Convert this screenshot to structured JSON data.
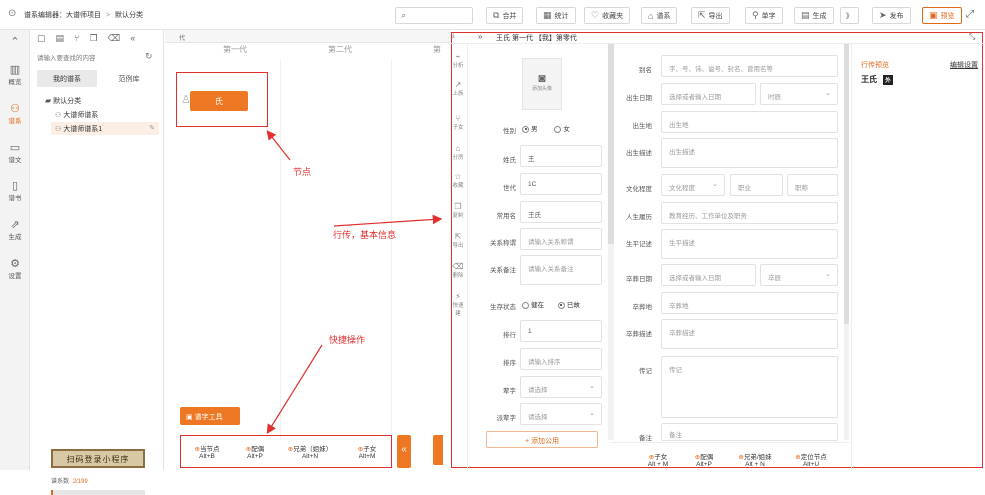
{
  "topbar": {
    "breadcrumb": {
      "root": "谱系编辑器：大谱师项目",
      "sep": ">",
      "current": "默认分类"
    },
    "search_icon": "search-icon",
    "buttons": [
      {
        "label": "合并"
      },
      {
        "label": "统计"
      },
      {
        "label": "收藏夹"
      },
      {
        "label": "谱系"
      },
      {
        "label": "导出"
      },
      {
        "label": "单字"
      },
      {
        "label": "生成"
      },
      {
        "label": "》"
      },
      {
        "label": "发布"
      },
      {
        "label": "预览"
      }
    ]
  },
  "leftbar": {
    "items": [
      {
        "label": "概览",
        "icon": "chart-icon"
      },
      {
        "label": "谱系",
        "icon": "people-icon",
        "active": true
      },
      {
        "label": "谱文",
        "icon": "document-icon"
      },
      {
        "label": "谱书",
        "icon": "book-icon"
      },
      {
        "label": "生成",
        "icon": "generate-icon"
      },
      {
        "label": "设置",
        "icon": "gear-icon"
      }
    ]
  },
  "tree": {
    "search_placeholder": "请输入要查找的内容",
    "tabs": [
      {
        "label": "我的谱系"
      },
      {
        "label": "范例库"
      }
    ],
    "folder": "默认分类",
    "items": [
      {
        "label": "大谱师谱系"
      },
      {
        "label": "大谱师谱系1"
      }
    ],
    "promo": "扫码登录小程序",
    "count_label": "谱系数",
    "count_value": "2/199"
  },
  "canvas": {
    "tab_label": "代",
    "columns": [
      "第一代",
      "第二代",
      "第"
    ],
    "node_label": "氏",
    "tool_button": "谱字工具",
    "shortcuts": [
      {
        "name": "当节点",
        "key": "Alt+B"
      },
      {
        "name": "配偶",
        "key": "Alt+P"
      },
      {
        "name": "兄弟（姐妹）",
        "key": "Alt+N"
      },
      {
        "name": "子女",
        "key": "Alt+M"
      }
    ]
  },
  "annotations": {
    "node": "节点",
    "panel": "行传，基本信息",
    "operation": "快捷操作"
  },
  "panel": {
    "header": "王氏 第一代 【我】第零代",
    "side_tabs": [
      "分析",
      "上族",
      "子女",
      "分房",
      "收藏",
      "复制",
      "导出",
      "删除",
      "快速建"
    ],
    "photo_label": "添加头像",
    "gender_label": "性别",
    "gender_male": "男",
    "gender_female": "女",
    "surname_label": "姓氏",
    "surname_value": "王",
    "gen_label": "世代",
    "gen_value": "1C",
    "common_name_label": "常用名",
    "common_name_value": "王氏",
    "relation_label": "关系称谓",
    "relation_placeholder": "请输入关系称谓",
    "relation_note_label": "关系备注",
    "relation_note_placeholder": "请输入关系备注",
    "alive_label": "生存状态",
    "alive_yes": "健在",
    "alive_no": "已故",
    "rank_label": "排行",
    "rank_value": "1",
    "order_label": "排序",
    "order_placeholder": "请输入排序",
    "gen_char_label": "辈字",
    "gen_char_placeholder": "请选择",
    "gen_char2_label": "派辈字",
    "gen_char2_placeholder": "请选择",
    "add_public_button": "+ 添加公用",
    "alias_label": "别名",
    "alias_placeholder": "字、号、讳、谥号、封名、曾用名等",
    "birth_date_label": "出生日期",
    "birth_date_placeholder": "选择或者输入日期",
    "birth_hour_placeholder": "时辰",
    "birthplace_label": "出生地",
    "birthplace_placeholder": "出生地",
    "birth_desc_label": "出生描述",
    "birth_desc_placeholder": "出生描述",
    "education_label": "文化程度",
    "education_placeholder": "文化程度",
    "job_placeholder": "职业",
    "title_placeholder": "职称",
    "career_label": "人生履历",
    "career_placeholder": "教育经历、工作单位及职务",
    "life_label": "生平记述",
    "life_placeholder": "生平描述",
    "death_date_label": "卒葬日期",
    "death_date_placeholder": "选择或者输入日期",
    "death_hour_placeholder": "卒辰",
    "burial_label": "卒葬地",
    "burial_placeholder": "卒葬地",
    "burial_desc_label": "卒葬描述",
    "burial_desc_placeholder": "卒葬描述",
    "bio_label": "传记",
    "bio_placeholder": "传记",
    "remark_label": "备注",
    "remark_placeholder": "备注",
    "preview_label": "行传预览",
    "preview_settings": "编辑设置",
    "preview_name": "王氏",
    "preview_badge": "外",
    "bottom_shortcuts": [
      {
        "name": "子女",
        "key": "Alt + M"
      },
      {
        "name": "配偶",
        "key": "Alt+P"
      },
      {
        "name": "兄弟/姐妹",
        "key": "Alt + N"
      },
      {
        "name": "定位节点",
        "key": "Alt+U"
      }
    ]
  }
}
